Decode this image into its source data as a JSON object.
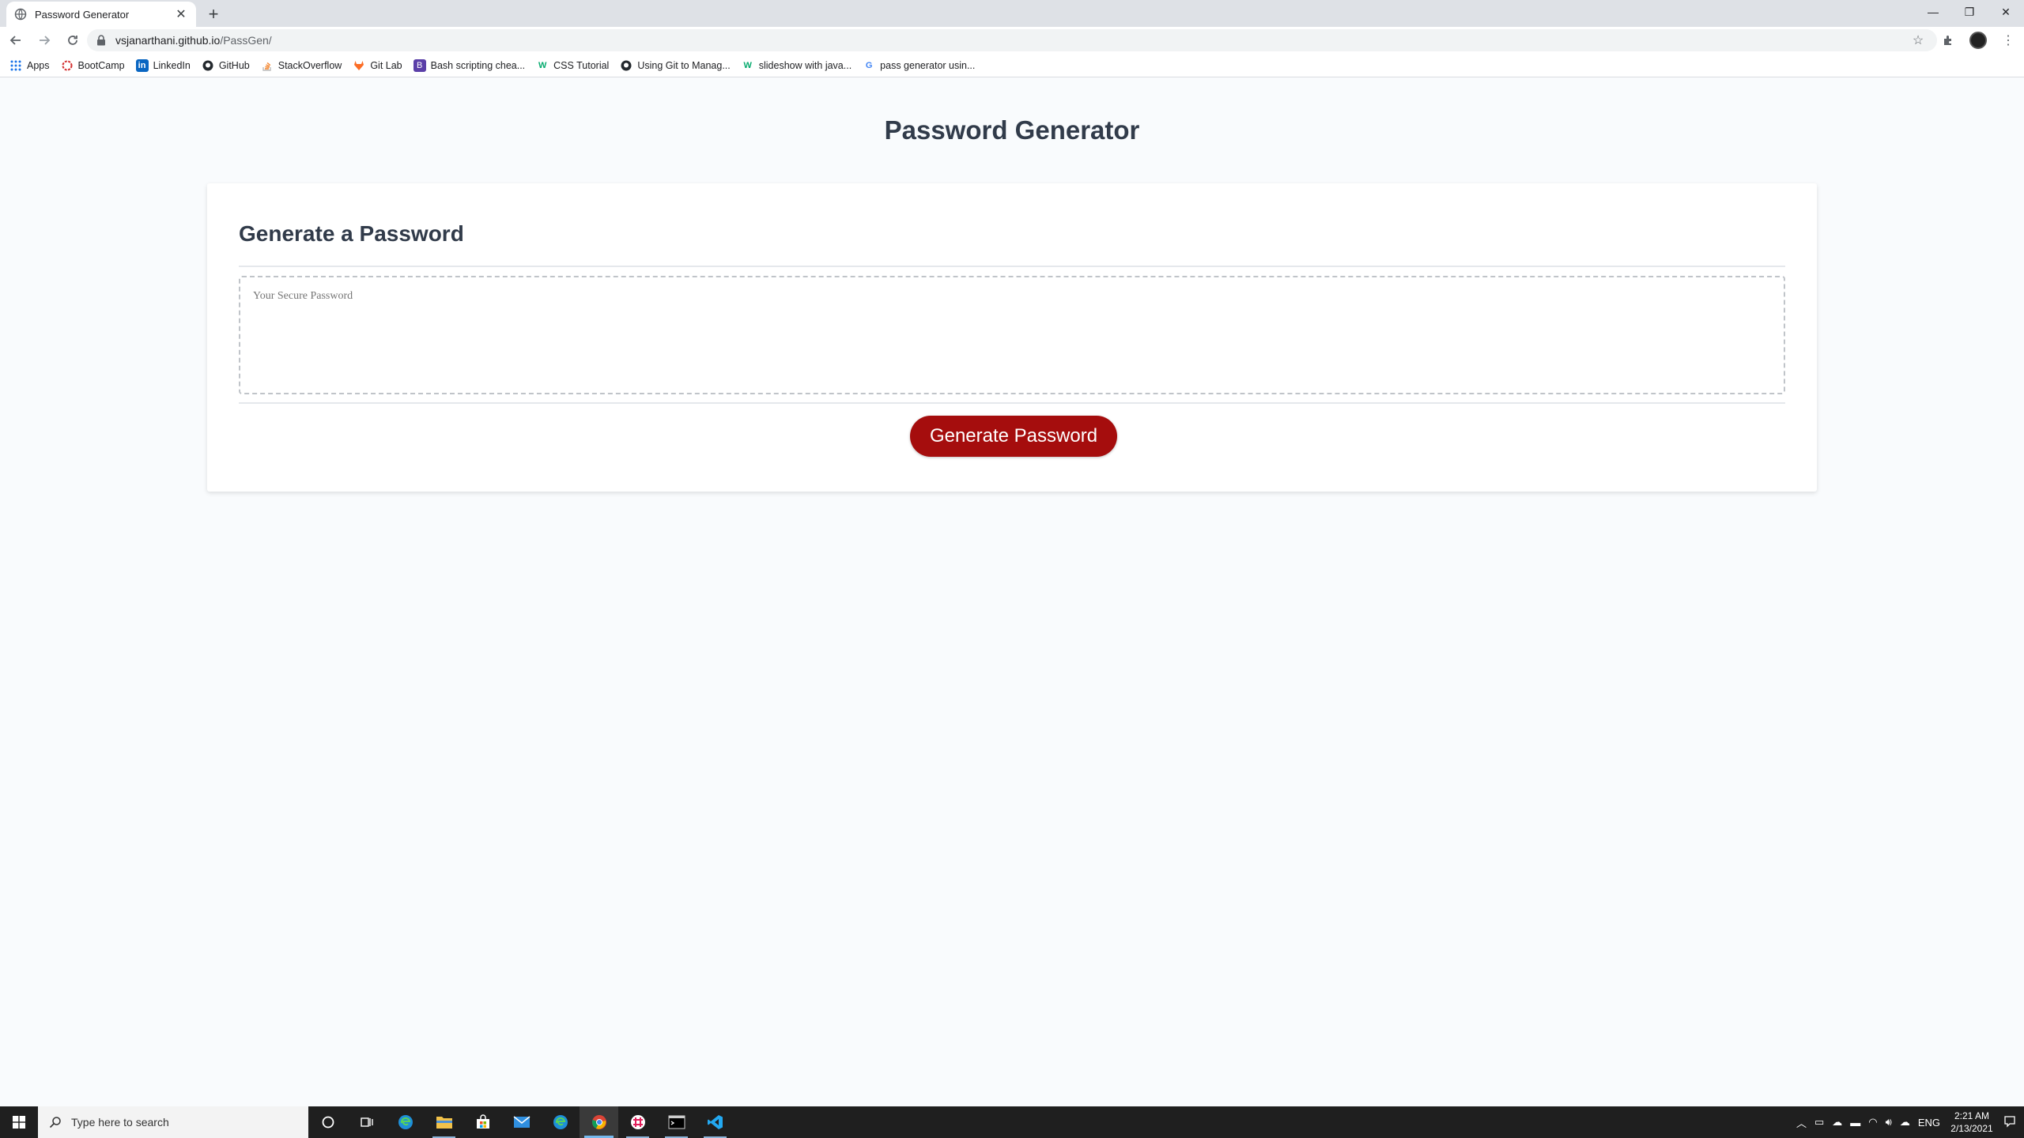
{
  "browser": {
    "tab_title": "Password Generator",
    "url_host": "vsjanarthani.github.io",
    "url_path": "/PassGen/",
    "bookmarks": [
      {
        "label": "Apps",
        "icon": "apps-grid-icon"
      },
      {
        "label": "BootCamp",
        "icon": "bootcamp-icon"
      },
      {
        "label": "LinkedIn",
        "icon": "linkedin-icon"
      },
      {
        "label": "GitHub",
        "icon": "github-icon"
      },
      {
        "label": "StackOverflow",
        "icon": "stackoverflow-icon"
      },
      {
        "label": "Git Lab",
        "icon": "gitlab-icon"
      },
      {
        "label": "Bash scripting chea...",
        "icon": "bash-icon"
      },
      {
        "label": "CSS Tutorial",
        "icon": "w3schools-icon"
      },
      {
        "label": "Using Git to Manag...",
        "icon": "github-icon"
      },
      {
        "label": "slideshow with java...",
        "icon": "w3schools-icon"
      },
      {
        "label": "pass generator usin...",
        "icon": "google-icon"
      }
    ]
  },
  "page": {
    "title": "Password Generator",
    "card_header": "Generate a Password",
    "password_placeholder": "Your Secure Password",
    "generate_button": "Generate Password",
    "button_color": "#a50d0d"
  },
  "taskbar": {
    "search_placeholder": "Type here to search",
    "language": "ENG",
    "time": "2:21 AM",
    "date": "2/13/2021"
  }
}
